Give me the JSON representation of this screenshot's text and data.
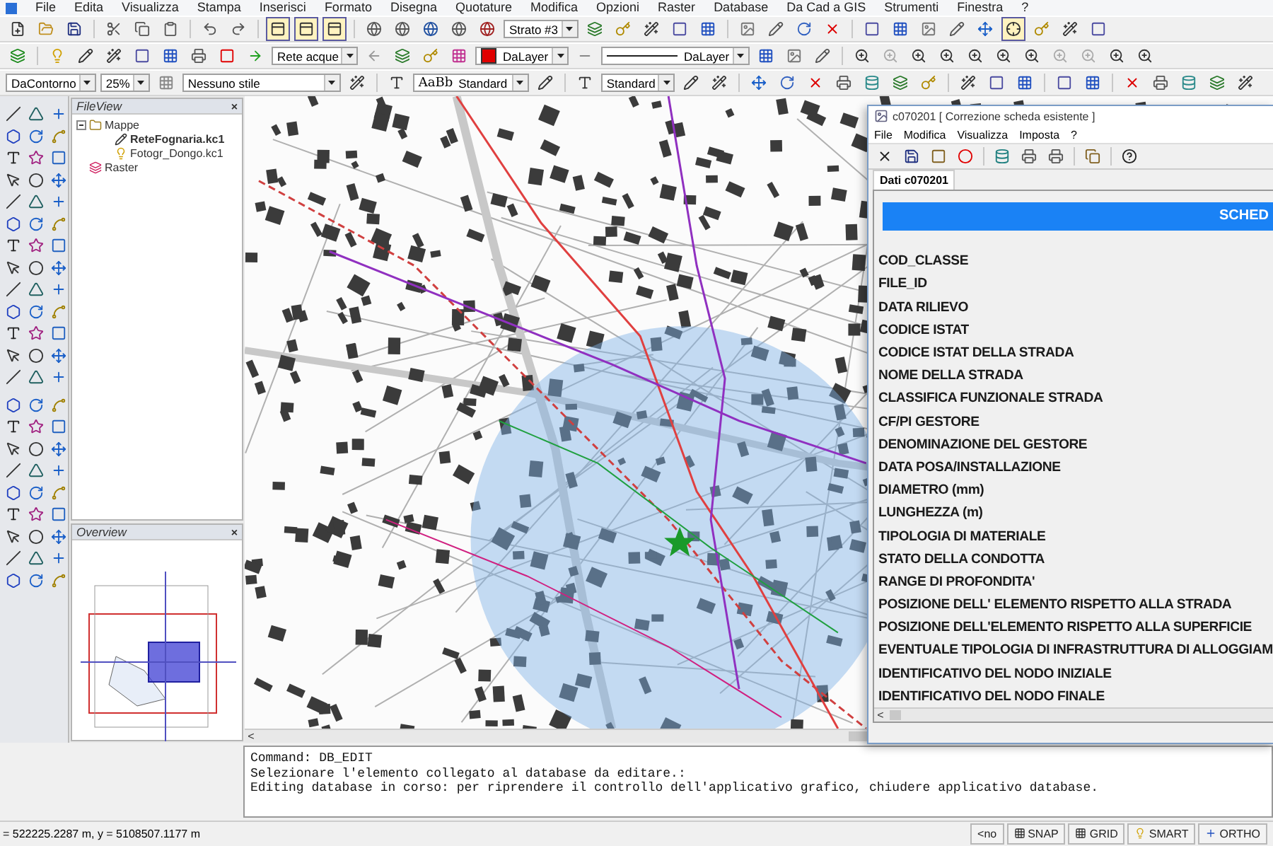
{
  "menu": [
    {
      "label": "File"
    },
    {
      "label": "Edita"
    },
    {
      "label": "Visualizza"
    },
    {
      "label": "Stampa"
    },
    {
      "label": "Inserisci"
    },
    {
      "label": "Formato"
    },
    {
      "label": "Disegna"
    },
    {
      "label": "Quotature"
    },
    {
      "label": "Modifica"
    },
    {
      "label": "Opzioni"
    },
    {
      "label": "Raster"
    },
    {
      "label": "Database"
    },
    {
      "label": "Da Cad a GIS"
    },
    {
      "label": "Strumenti"
    },
    {
      "label": "Finestra"
    },
    {
      "label": "?"
    }
  ],
  "toolbars": [
    {
      "combos": [
        {
          "kind": "text",
          "value": "Strato #3"
        }
      ]
    },
    {
      "combos": [
        {
          "kind": "text",
          "value": "Rete acque"
        },
        {
          "kind": "color",
          "value": "DaLayer",
          "color": "#e00000"
        },
        {
          "kind": "line",
          "value": "DaLayer"
        }
      ]
    },
    {
      "combos": [
        {
          "kind": "text",
          "value": "DaContorno"
        },
        {
          "kind": "text",
          "value": "25%"
        },
        {
          "kind": "text",
          "value": "Nessuno stile"
        },
        {
          "kind": "font",
          "sample": "AaBb",
          "value": "Standard"
        },
        {
          "kind": "text",
          "value": "Standard"
        }
      ]
    }
  ],
  "file_view": {
    "title": "FileView",
    "close": "×",
    "tree": [
      {
        "label": "Mappe",
        "kind": "folder",
        "expanded": true,
        "children": [
          {
            "label": "ReteFognaria.kc1",
            "kind": "map",
            "active": true
          },
          {
            "label": "Fotogr_Dongo.kc1",
            "kind": "photo",
            "active": false
          }
        ]
      },
      {
        "label": "Raster",
        "kind": "raster"
      }
    ]
  },
  "overview": {
    "title": "Overview",
    "close": "×"
  },
  "map": {
    "scroll_arrow": "<"
  },
  "dialog": {
    "title": "c070201 [ Correzione scheda esistente ]",
    "menu": [
      "File",
      "Modifica",
      "Visualizza",
      "Imposta",
      "?"
    ],
    "tab": {
      "label": "Dati c070201",
      "selected": true
    },
    "header": "SCHED",
    "fields": [
      "COD_CLASSE",
      "FILE_ID",
      "DATA RILIEVO",
      "CODICE ISTAT",
      "CODICE ISTAT DELLA STRADA",
      "NOME DELLA STRADA",
      "CLASSIFICA FUNZIONALE STRADA",
      "CF/PI GESTORE",
      "DENOMINAZIONE DEL GESTORE",
      "DATA POSA/INSTALLAZIONE",
      "DIAMETRO (mm)",
      "LUNGHEZZA (m)",
      "TIPOLOGIA DI MATERIALE",
      "STATO DELLA CONDOTTA",
      "RANGE DI PROFONDITA'",
      "POSIZIONE DELL' ELEMENTO RISPETTO ALLA STRADA",
      "POSIZIONE DELL'ELEMENTO RISPETTO ALLA SUPERFICIE",
      "EVENTUALE TIPOLOGIA DI INFRASTRUTTURA DI ALLOGGIAM",
      "IDENTIFICATIVO DEL NODO INIZIALE",
      "IDENTIFICATIVO DEL NODO FINALE"
    ],
    "scroll_arrow": "<"
  },
  "command": [
    "Command: DB_EDIT",
    "Selezionare l'elemento collegato al database da editare.:",
    "Editing database in corso: per riprendere il controllo dell'applicativo grafico, chiudere applicativo database."
  ],
  "status": {
    "coordinates": "= 522225.2287 m, y = 5108507.1177 m",
    "toggles": [
      {
        "label": "<no",
        "kind": "plain"
      },
      {
        "label": "SNAP",
        "kind": "snap"
      },
      {
        "label": "GRID",
        "kind": "grid"
      },
      {
        "label": "SMART",
        "kind": "smart"
      },
      {
        "label": "ORTHO",
        "kind": "ortho"
      }
    ]
  }
}
